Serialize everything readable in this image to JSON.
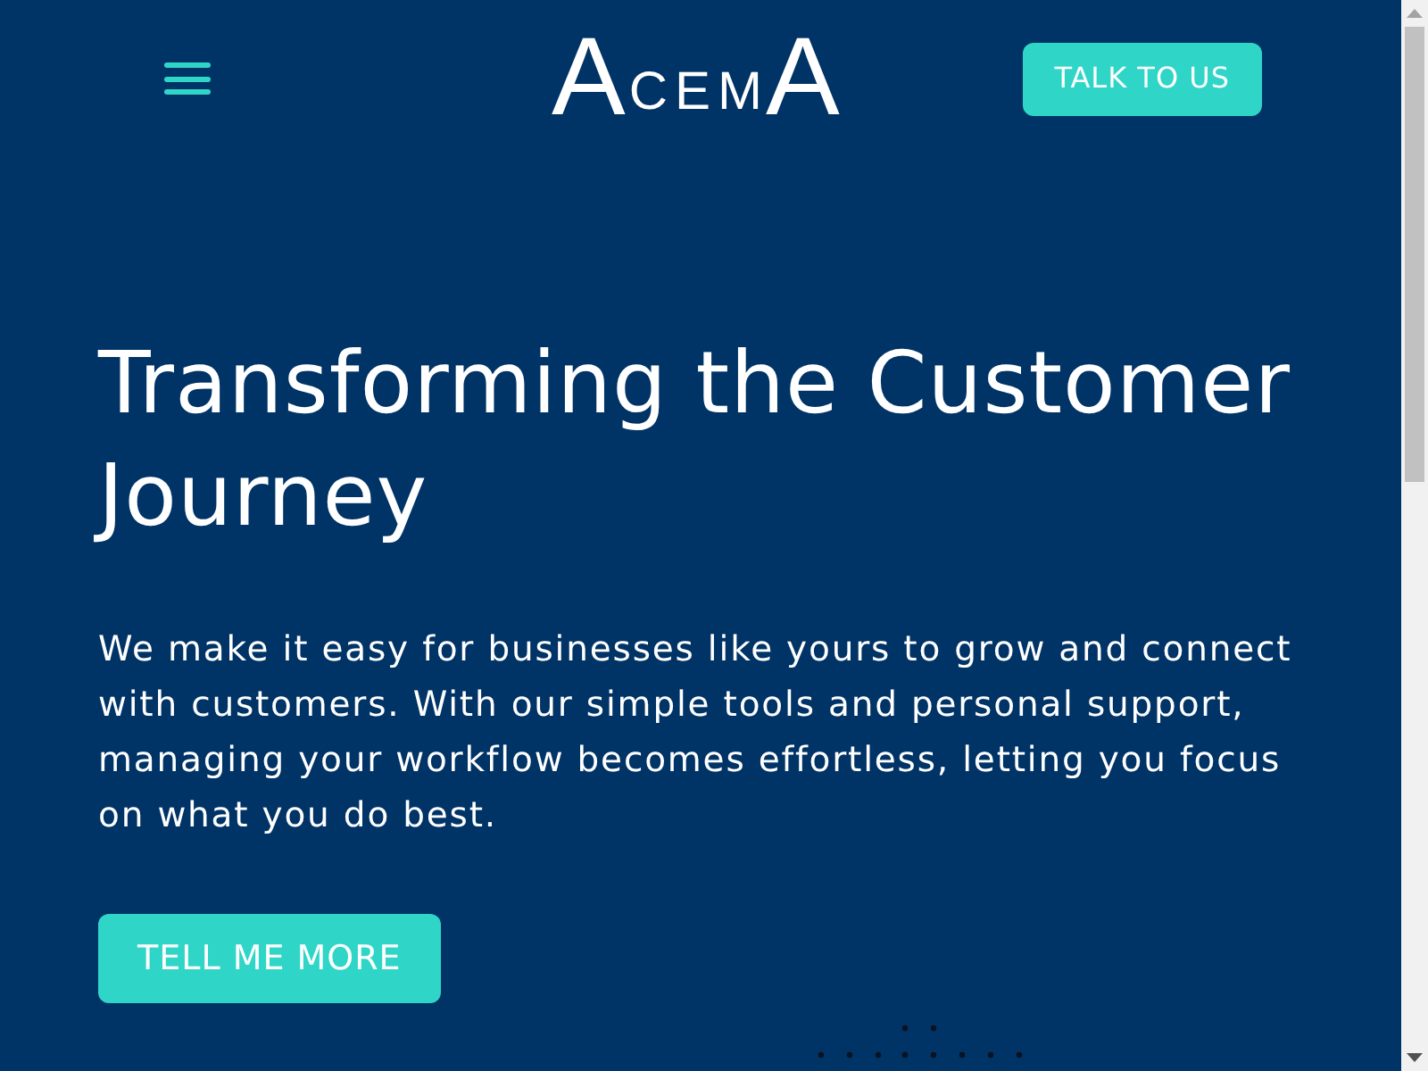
{
  "header": {
    "logo": "ACEMA",
    "cta_button": "TALK TO US"
  },
  "hero": {
    "title": "Transforming the Customer Journey",
    "description": "We make it easy for businesses like yours to grow and connect with customers. With our simple tools and personal support, managing your workflow becomes effortless, letting you focus on what you do best.",
    "button": "TELL ME MORE"
  }
}
